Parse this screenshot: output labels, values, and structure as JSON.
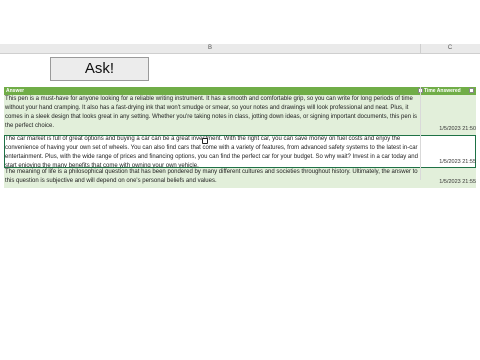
{
  "columns": {
    "b": "B",
    "c": "C"
  },
  "ask_button": {
    "label": "Ask!"
  },
  "table": {
    "headers": {
      "answer": "Answer",
      "time": "Time Answered"
    },
    "rows": [
      {
        "answer": "This pen is a must-have for anyone looking for a reliable writing instrument. It has a smooth and comfortable grip, so you can write for long periods of time without your hand cramping. It also has a fast-drying ink that won't smudge or smear, so your notes and drawings will look professional and neat. Plus, it comes in a sleek design that looks great in any setting. Whether you're taking notes in class, jotting down ideas, or signing important documents, this pen is the perfect choice.",
        "time": "1/5/2023 21:50"
      },
      {
        "answer": "The car market is full of great options and buying a car can be a great investment. With the right car, you can save money on fuel costs and enjoy the convenience of having your own set of wheels. You can also find cars that come with a variety of features, from advanced safety systems to the latest in-car entertainment. Plus, with the wide range of prices and financing options, you can find the perfect car for your budget. So why wait? Invest in a car today and start enjoying the many benefits that come with owning your own vehicle.",
        "time": "1/5/2023 21:55"
      },
      {
        "answer": "The meaning of life is a philosophical question that has been pondered by many different cultures and societies throughout history. Ultimately, the answer to this question is subjective and will depend on one's personal beliefs and values.",
        "time": "1/5/2023 21:55"
      }
    ]
  }
}
